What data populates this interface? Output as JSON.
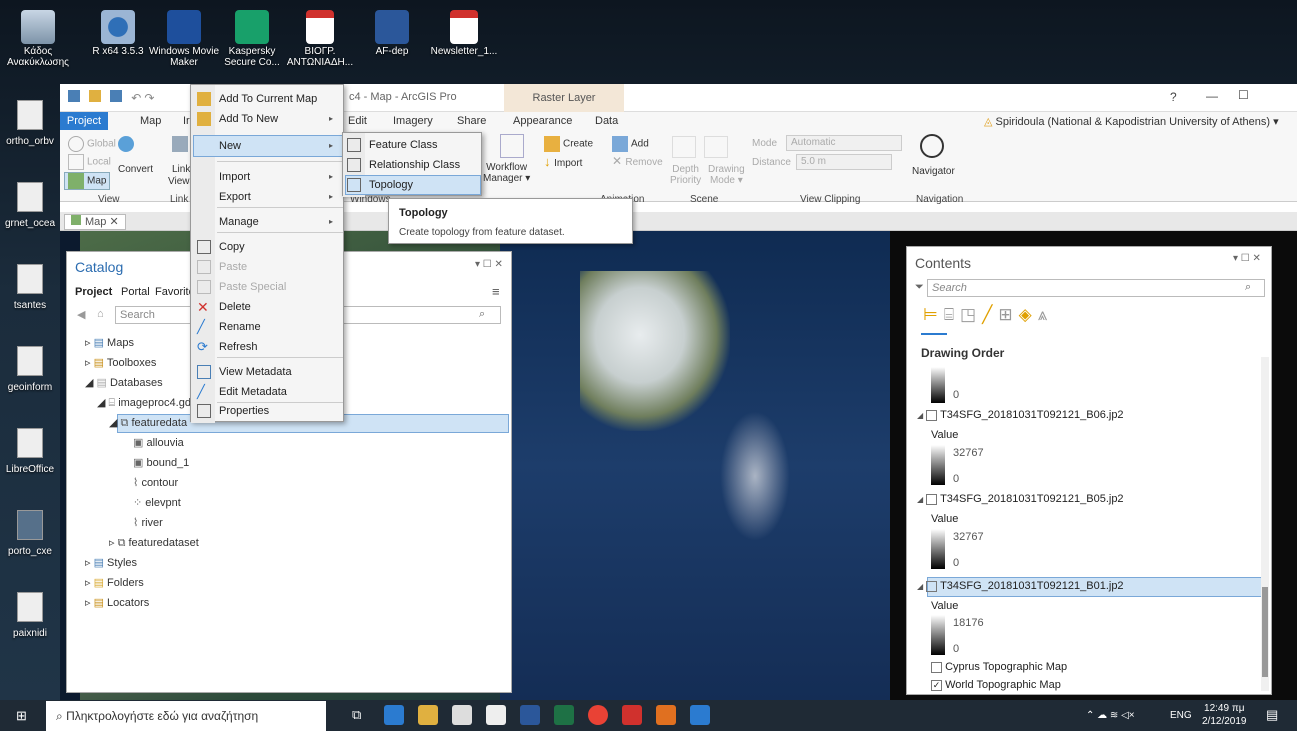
{
  "desktop": {
    "top_icons": [
      {
        "label": "Κάδος Ανακύκλωσης"
      },
      {
        "label": "R x64 3.5.3"
      },
      {
        "label": "Windows Movie Maker"
      },
      {
        "label": "Kaspersky Secure Co..."
      },
      {
        "label": "ΒΙΟΓΡ. ΑΝΤΩΝΙΑΔΗ..."
      },
      {
        "label": "AF-dep"
      },
      {
        "label": "Newsletter_1..."
      }
    ],
    "left_icons": [
      {
        "label": "ortho_orbv"
      },
      {
        "label": "grnet_ocea"
      },
      {
        "label": "tsantes"
      },
      {
        "label": "geoinform"
      },
      {
        "label": "LibreOffice"
      },
      {
        "label": "porto_cxe"
      },
      {
        "label": "paixnidi"
      }
    ]
  },
  "titlebar": {
    "title": "c4 - Map - ArcGIS Pro",
    "context_tab": "Raster Layer",
    "help": "?",
    "minimize": "—",
    "maximize": "☐",
    "user": "Spiridoula (National & Kapodistrian University of Athens) ▾"
  },
  "ribbon": {
    "tabs": {
      "project": "Project",
      "map": "Map",
      "insert": "Ir",
      "edit": "Edit",
      "imagery": "Imagery",
      "share": "Share",
      "appearance": "Appearance",
      "data": "Data"
    },
    "view": {
      "global": "Global",
      "local": "Local",
      "map": "Map",
      "convert": "Convert",
      "link": "Link",
      "views": "Views",
      "group_view": "View",
      "group_link": "Link"
    },
    "windows": {
      "workflow": "Workflow",
      "manager": "Manager ▾",
      "group": "Windows"
    },
    "edit": {
      "create": "Create",
      "import": "Import",
      "add": "Add",
      "remove": "Remove"
    },
    "scene": {
      "depth": "Depth",
      "priority": "Priority",
      "drawing": "Drawing",
      "mode": "Mode ▾",
      "group": "Scene"
    },
    "clipping": {
      "mode_label": "Mode",
      "mode_value": "Automatic",
      "distance_label": "Distance",
      "distance_value": "5.0 m",
      "group": "View Clipping"
    },
    "navigation": {
      "navigator": "Navigator",
      "group": "Navigation"
    },
    "group_animation": "Animation"
  },
  "doc_tab": {
    "label": "Map",
    "close": "✕"
  },
  "context_menu": {
    "items": [
      {
        "label": "Add To Current Map",
        "disabled": false
      },
      {
        "label": "Add To New",
        "disabled": false
      },
      {
        "label": "New",
        "disabled": false
      },
      {
        "label": "Import",
        "disabled": false
      },
      {
        "label": "Export",
        "disabled": false
      },
      {
        "label": "Manage",
        "disabled": false
      },
      {
        "label": "Copy",
        "disabled": false
      },
      {
        "label": "Paste",
        "disabled": true
      },
      {
        "label": "Paste Special",
        "disabled": true
      },
      {
        "label": "Delete",
        "disabled": false
      },
      {
        "label": "Rename",
        "disabled": false
      },
      {
        "label": "Refresh",
        "disabled": false
      },
      {
        "label": "View Metadata",
        "disabled": false
      },
      {
        "label": "Edit Metadata",
        "disabled": false
      },
      {
        "label": "Properties",
        "disabled": false
      }
    ]
  },
  "submenu": {
    "items": [
      {
        "label": "Feature Class"
      },
      {
        "label": "Relationship Class"
      },
      {
        "label": "Topology"
      }
    ]
  },
  "tooltip": {
    "title": "Topology",
    "text": "Create topology from feature dataset."
  },
  "catalog": {
    "title": "Catalog",
    "tabs": {
      "project": "Project",
      "portal": "Portal",
      "favorites": "Favorite"
    },
    "search_placeholder": "Search",
    "tree": [
      {
        "label": "Maps"
      },
      {
        "label": "Toolboxes"
      },
      {
        "label": "Databases"
      },
      {
        "label": "imageproc4.gd"
      },
      {
        "label": "featuredata"
      },
      {
        "label": "allouvia"
      },
      {
        "label": "bound_1"
      },
      {
        "label": "contour"
      },
      {
        "label": "elevpnt"
      },
      {
        "label": "river"
      },
      {
        "label": "featuredataset"
      },
      {
        "label": "Styles"
      },
      {
        "label": "Folders"
      },
      {
        "label": "Locators"
      }
    ]
  },
  "contents": {
    "title": "Contents",
    "search_placeholder": "Search",
    "drawing_order": "Drawing Order",
    "layers": [
      {
        "name": "T34SFG_20181031T092121_B06.jp2",
        "value_label": "Value",
        "max": "32767",
        "min": "0"
      },
      {
        "name": "T34SFG_20181031T092121_B05.jp2",
        "value_label": "Value",
        "max": "32767",
        "min": "0"
      },
      {
        "name": "T34SFG_20181031T092121_B01.jp2",
        "value_label": "Value",
        "max": "18176",
        "min": "0"
      }
    ],
    "top_min": "0",
    "basemaps": [
      {
        "name": "Cyprus Topographic Map",
        "checked": false
      },
      {
        "name": "World Topographic Map",
        "checked": true
      }
    ]
  },
  "taskbar": {
    "search": "Πληκτρολογήστε εδώ για αναζήτηση",
    "lang": "ENG",
    "time": "12:49 πμ",
    "date": "2/12/2019"
  }
}
